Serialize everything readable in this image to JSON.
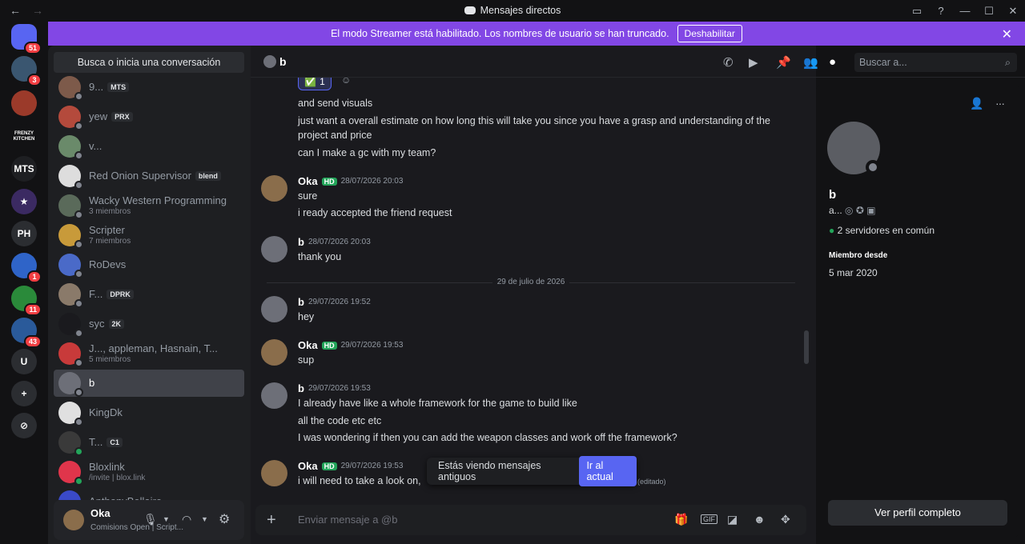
{
  "window": {
    "title": "Mensajes directos",
    "back": "←",
    "forward": "→",
    "min": "—",
    "max": "☐",
    "close": "✕"
  },
  "servers": [
    {
      "label": "",
      "badge": "51",
      "color": "#5865f2"
    },
    {
      "label": "",
      "badge": "3",
      "color": "#3a5670"
    },
    {
      "label": "",
      "badge": "",
      "color": "#9b3a2a"
    },
    {
      "label": "FRENZY KITCHEN",
      "badge": "",
      "color": "#121214"
    },
    {
      "label": "MTS",
      "badge": "",
      "color": "#1e1f22"
    },
    {
      "label": "★",
      "badge": "",
      "color": "#3b2a62"
    },
    {
      "label": "PH",
      "badge": "",
      "color": "#2b2d31"
    },
    {
      "label": "",
      "badge": "1",
      "color": "#2f64c8"
    },
    {
      "label": "",
      "badge": "11",
      "color": "#2a8a3a"
    },
    {
      "label": "",
      "badge": "43",
      "color": "#2a5a9a"
    },
    {
      "label": "U",
      "badge": "",
      "color": "#2b2d31"
    },
    {
      "label": "+",
      "badge": "",
      "color": "#2b2d31"
    },
    {
      "label": "⊘",
      "badge": "",
      "color": "#2b2d31"
    }
  ],
  "banner": {
    "text": "El modo Streamer está habilitado. Los nombres de usuario se han truncado.",
    "button": "Deshabilitar",
    "close": "✕"
  },
  "search_placeholder": "Busca o inicia una conversación",
  "dms": [
    {
      "name": "9...",
      "tag": "MTS",
      "sub": "",
      "color": "#7d5a4a",
      "online": false
    },
    {
      "name": "yew",
      "tag": "PRX",
      "sub": "",
      "color": "#b44a3c",
      "online": false
    },
    {
      "name": "v...",
      "tag": "",
      "sub": "",
      "color": "#6a8a6a",
      "online": false
    },
    {
      "name": "Red Onion Supervisor",
      "tag": "blend",
      "sub": "",
      "color": "#dddddd",
      "online": false
    },
    {
      "name": "Wacky Western Programming",
      "tag": "",
      "sub": "3 miembros",
      "color": "#5a6a5a",
      "online": false
    },
    {
      "name": "Scripter",
      "tag": "",
      "sub": "7 miembros",
      "color": "#c89a3a",
      "online": false
    },
    {
      "name": "RoDevs",
      "tag": "",
      "sub": "",
      "color": "#4a6ac8",
      "online": false
    },
    {
      "name": "F...",
      "tag": "DPRK",
      "sub": "",
      "color": "#8a7a6a",
      "online": false
    },
    {
      "name": "syc",
      "tag": "2K",
      "sub": "",
      "color": "#1a1a1e",
      "online": false
    },
    {
      "name": "J..., appleman, Hasnain, T...",
      "tag": "",
      "sub": "5 miembros",
      "color": "#c83a3a",
      "online": false
    },
    {
      "name": "b",
      "tag": "",
      "sub": "",
      "color": "#6d6f78",
      "online": false,
      "selected": true
    },
    {
      "name": "KingDk",
      "tag": "",
      "sub": "",
      "color": "#e0e0e0",
      "online": false
    },
    {
      "name": "T...",
      "tag": "C1",
      "sub": "",
      "color": "#3a3a3a",
      "online": true
    },
    {
      "name": "Bloxlink",
      "tag": "",
      "sub": "/invite | blox.link",
      "color": "#e0354b",
      "online": true
    },
    {
      "name": "AnthonyBellaire",
      "tag": "",
      "sub": "",
      "color": "#3a4ac8",
      "online": false
    }
  ],
  "user": {
    "name": "Oka",
    "status": "Comisions Open | Script...",
    "mic": "🎤",
    "headset": "🎧",
    "settings": "⚙"
  },
  "header": {
    "name": "b",
    "search_placeholder": "Buscar a...",
    "search_icon": "⌕"
  },
  "reaction": {
    "emoji": "✅",
    "count": "1"
  },
  "messages": [
    {
      "author": "",
      "time": "",
      "lines": [
        "and send visuals",
        "just want a overall estimate on how long this will take you since you have a grasp and understanding of the project and price",
        "can I make a gc with my team?"
      ]
    },
    {
      "author": "Oka",
      "hd": "HD",
      "time": "28/07/2026 20:03",
      "lines": [
        "sure",
        "i ready accepted the friend request"
      ]
    },
    {
      "author": "b",
      "hd": "",
      "time": "28/07/2026 20:03",
      "lines": [
        "thank you"
      ]
    },
    {
      "author": "b",
      "hd": "",
      "time": "29/07/2026 19:52",
      "lines": [
        "hey"
      ]
    },
    {
      "author": "Oka",
      "hd": "HD",
      "time": "29/07/2026 19:53",
      "lines": [
        "sup"
      ]
    },
    {
      "author": "b",
      "hd": "",
      "time": "29/07/2026 19:53",
      "lines": [
        "I already have like a whole framework for the game to build like",
        "all the code etc etc",
        "I was wondering if then you can add the weapon classes and work off the framework?"
      ]
    },
    {
      "author": "Oka",
      "hd": "HD",
      "time": "29/07/2026 19:53",
      "lines": [
        "i will need to take a look on,"
      ],
      "edited": "(editado)"
    }
  ],
  "date_divider": "29 de julio de 2026",
  "older_notice": {
    "text": "Estás viendo mensajes antiguos",
    "button": "Ir al actual"
  },
  "composer": {
    "placeholder": "Enviar mensaje a @b",
    "plus": "+"
  },
  "profile": {
    "name": "b",
    "username": "a...",
    "mutual": "2 servidores en común",
    "member_since_label": "Miembro desde",
    "member_since": "5 mar 2020",
    "full_button": "Ver perfil completo",
    "more": "···"
  }
}
